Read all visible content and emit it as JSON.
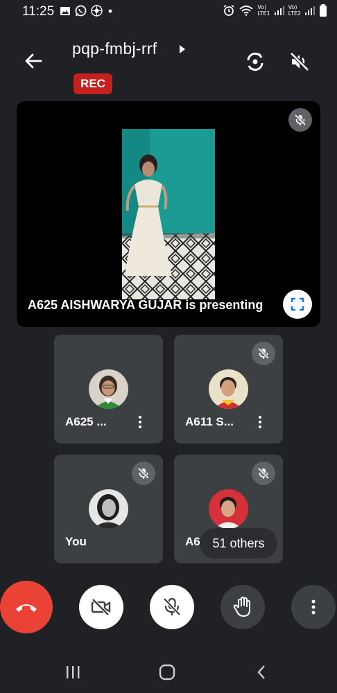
{
  "status_bar": {
    "time": "11:25",
    "sim1_top": "Vo)",
    "sim1_bottom": "LTE1",
    "sim2_top": "Vo)",
    "sim2_bottom": "LTE2"
  },
  "header": {
    "meeting_code": "pqp-fmbj-rrf",
    "rec_label": "REC"
  },
  "presentation": {
    "presenting_text": "A625 AISHWARYA GUJAR is presenting"
  },
  "tiles": [
    {
      "name": "A625 ...",
      "muted": false,
      "has_menu": true
    },
    {
      "name": "A611 S...",
      "muted": true,
      "has_menu": true
    },
    {
      "name": "You",
      "muted": true,
      "has_menu": false
    },
    {
      "name": "A60_Mukun",
      "muted": true,
      "has_menu": false
    }
  ],
  "others_label": "51 others",
  "colors": {
    "background": "#202124",
    "tile": "#3c4043",
    "end_call": "#ea4335",
    "rec": "#c5221f",
    "accent_blue": "#1a73e8"
  },
  "icons": {
    "back": "arrow-left-icon",
    "switch_camera": "switch-camera-icon",
    "speaker_off": "speaker-off-icon",
    "mic_off": "mic-off-icon",
    "fullscreen": "fullscreen-icon",
    "end_call": "phone-hangup-icon",
    "camera_off": "camera-off-icon",
    "raise_hand": "hand-icon",
    "more": "more-vertical-icon"
  }
}
